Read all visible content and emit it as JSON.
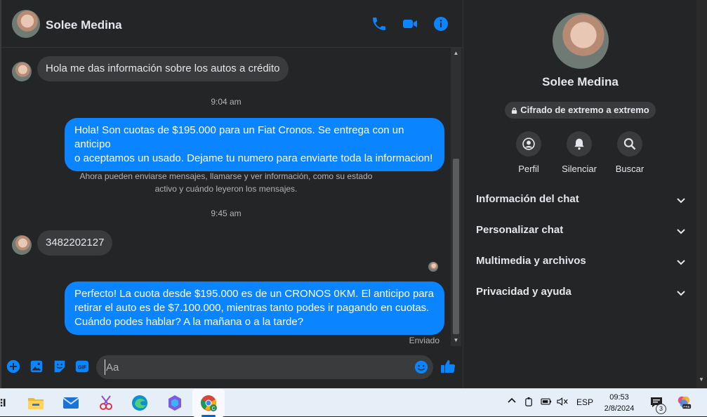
{
  "contact": {
    "name": "Solee Medina"
  },
  "messages": {
    "m1": "Hola me das información sobre los autos a crédito",
    "t1": "9:04 am",
    "m2_line1": "Hola! Son cuotas de $195.000 para un Fiat Cronos. Se entrega con un anticipo",
    "m2_line2": "o aceptamos un usado. Dejame tu numero para enviarte toda la informacion!",
    "note_line1": "Ahora pueden enviarse mensajes, llamarse y ver información, como su estado",
    "note_line2": "activo y cuándo leyeron los mensajes.",
    "t2": "9:45 am",
    "m3": "3482202127",
    "m4_line1": "Perfecto! La cuota desde $195.000 es de un CRONOS 0KM. El anticipo para",
    "m4_line2": "retirar el auto es de $7.100.000, mientras tanto podes ir pagando en cuotas.",
    "m4_line3": "Cuándo podes hablar? A la mañana o a la tarde?",
    "status": "Enviado"
  },
  "composer": {
    "placeholder": "Aa"
  },
  "info": {
    "name": "Solee Medina",
    "e2e": "Cifrado de extremo a extremo",
    "actions": {
      "profile": "Perfil",
      "mute": "Silenciar",
      "search": "Buscar"
    },
    "sections": {
      "chat_info": "Información del chat",
      "customize": "Personalizar chat",
      "media": "Multimedia y archivos",
      "privacy": "Privacidad y ayuda"
    }
  },
  "taskbar": {
    "language": "ESP",
    "time": "09:53",
    "date": "2/8/2024",
    "notification_count": "3"
  },
  "colors": {
    "accent": "#0a84ff",
    "background": "#242526",
    "bubble_in": "#3a3b3c"
  }
}
